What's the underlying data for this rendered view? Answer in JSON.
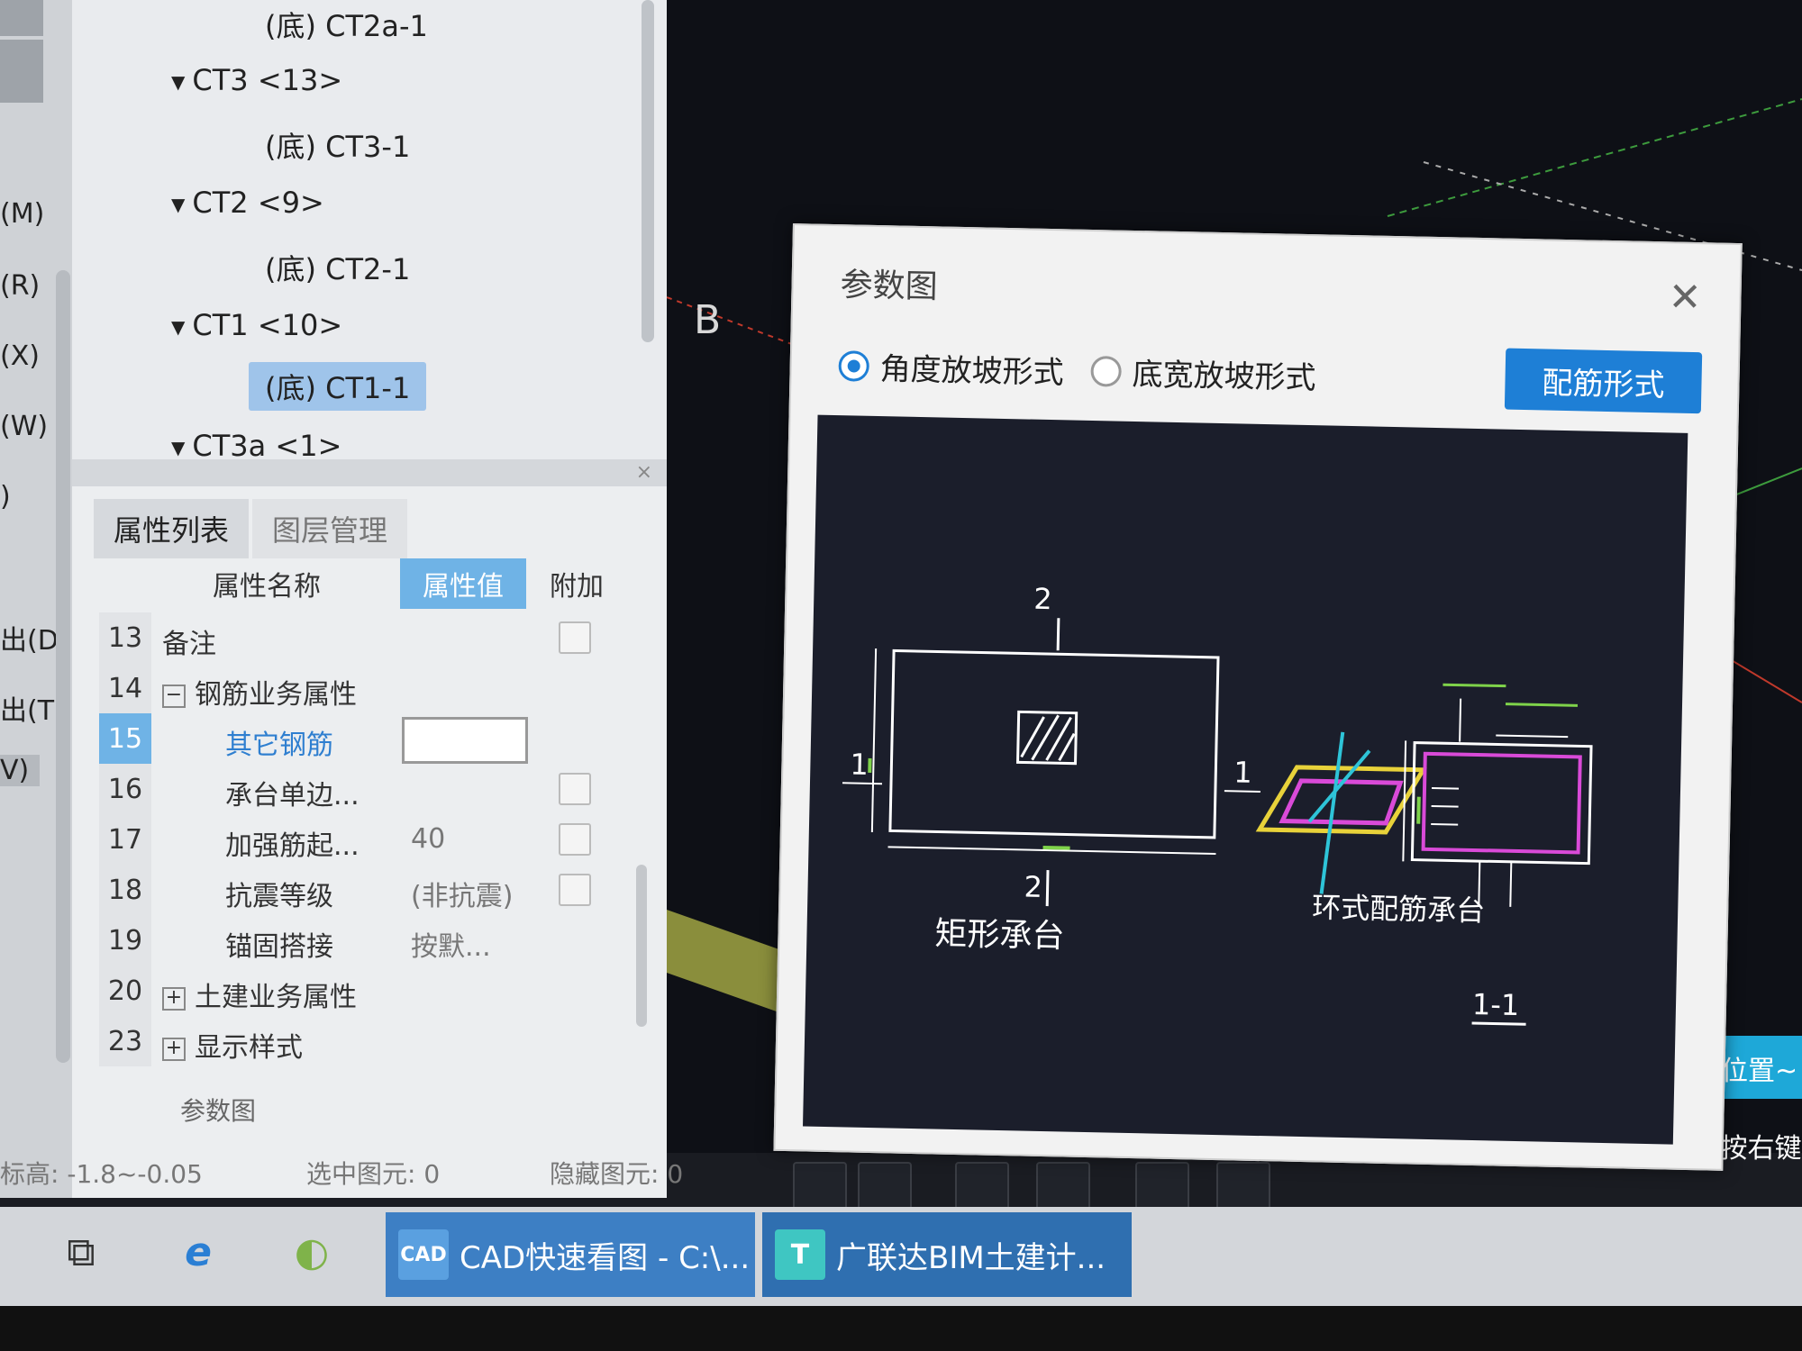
{
  "left_strip": {
    "labels": [
      "(M)",
      "(R)",
      "(X)",
      "(W)",
      ")",
      "出(D)",
      "出(T)",
      "V)"
    ]
  },
  "tree": {
    "items": [
      {
        "text": "(底) CT2a-1",
        "level": 2
      },
      {
        "text": "CT3 <13>",
        "level": 1
      },
      {
        "text": "(底) CT3-1",
        "level": 2
      },
      {
        "text": "CT2 <9>",
        "level": 1
      },
      {
        "text": "(底) CT2-1",
        "level": 2
      },
      {
        "text": "CT1 <10>",
        "level": 1
      },
      {
        "text": "(底) CT1-1",
        "level": 2,
        "selected": true
      },
      {
        "text": "CT3a <1>",
        "level": 1
      }
    ],
    "expand_arrow": "▼",
    "close": "×"
  },
  "props": {
    "tab_active": "属性列表",
    "tab_inactive": "图层管理",
    "col_name": "属性名称",
    "col_value": "属性值",
    "col_extra": "附加",
    "rows": [
      {
        "num": "13",
        "name": "备注",
        "value": "",
        "check": true
      },
      {
        "num": "14",
        "name": "钢筋业务属性",
        "value": "",
        "toggle": "−"
      },
      {
        "num": "15",
        "name": "其它钢筋",
        "value": "",
        "highlight": true
      },
      {
        "num": "16",
        "name": "承台单边...",
        "value": "",
        "check": true
      },
      {
        "num": "17",
        "name": "加强筋起...",
        "value": "40",
        "check": true
      },
      {
        "num": "18",
        "name": "抗震等级",
        "value": "(非抗震)",
        "check": true
      },
      {
        "num": "19",
        "name": "锚固搭接",
        "value": "按默..."
      },
      {
        "num": "20",
        "name": "土建业务属性",
        "value": "",
        "toggle": "+"
      },
      {
        "num": "23",
        "name": "显示样式",
        "value": "",
        "toggle": "+"
      }
    ],
    "params_link": "参数图"
  },
  "status": {
    "elevation": "标高:  -1.8~-0.05",
    "selected": "选中图元: 0",
    "hidden": "隐藏图元: 0"
  },
  "viewport": {
    "axis_label": "B",
    "tip1": "息位置~",
    "tip2": "点,按右键"
  },
  "dialog": {
    "title": "参数图",
    "close": "✕",
    "radio1": "角度放坡形式",
    "radio2": "底宽放坡形式",
    "rebar_button": "配筋形式",
    "diagram": {
      "dim_top": "2",
      "dim_bottom": "2",
      "dim_left": "1",
      "dim_right": "1",
      "caption_left": "矩形承台",
      "caption_right": "环式配筋承台",
      "section": "1-1"
    }
  },
  "taskbar": {
    "task1": "CAD快速看图 - C:\\...",
    "task1_icon": "CAD",
    "task2": "广联达BIM土建计...",
    "task2_icon": "T"
  },
  "colors": {
    "accent": "#1e7fd6",
    "highlight": "#6fb3e6",
    "selected": "#9fc4ea",
    "canvas": "#1b1e2b"
  }
}
